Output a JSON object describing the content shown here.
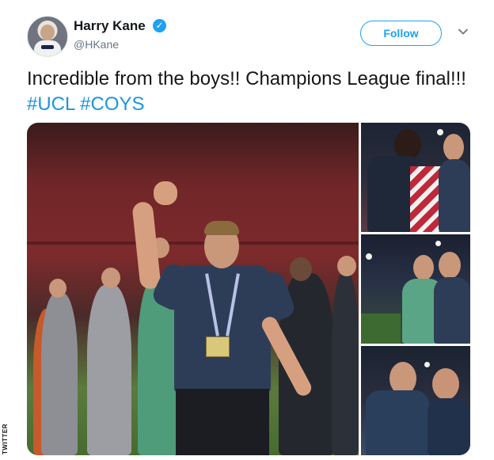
{
  "author": {
    "name": "Harry Kane",
    "handle": "@HKane",
    "verified_icon": "verified-badge-icon"
  },
  "actions": {
    "follow_label": "Follow",
    "menu_icon": "chevron-down-icon"
  },
  "tweet": {
    "text": "Incredible from the boys!! Champions League final!!!",
    "hashtags": [
      "#UCL",
      "#COYS"
    ]
  },
  "media": {
    "photo_count": 4
  },
  "watermark": "TWITTER",
  "colors": {
    "link": "#1b95e0",
    "follow_border": "#1da1f2",
    "text": "#14171a",
    "secondary": "#657786"
  }
}
